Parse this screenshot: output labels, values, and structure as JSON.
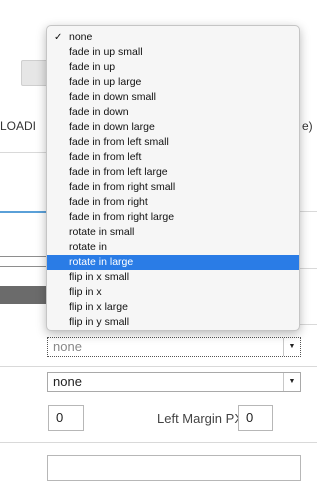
{
  "background": {
    "cut_label_left": "LOADI",
    "cut_label_right": "e)"
  },
  "animation_select": {
    "value": "none",
    "options": [
      "none",
      "fade in up small",
      "fade in up",
      "fade in up large",
      "fade in down small",
      "fade in down",
      "fade in down large",
      "fade in from left small",
      "fade in from left",
      "fade in from left large",
      "fade in from right small",
      "fade in from right",
      "fade in from right large",
      "rotate in small",
      "rotate in",
      "rotate in large",
      "flip in x small",
      "flip in x",
      "flip in x large",
      "flip in y small"
    ],
    "checked_option": "none",
    "highlighted_option": "rotate in large"
  },
  "second_select": {
    "value": "none"
  },
  "margins": {
    "top_value": "0",
    "left_label": "Left Margin PX",
    "left_value": "0"
  },
  "colors": {
    "highlight": "#2a7ce6",
    "accent_line": "#5aa0d8"
  }
}
